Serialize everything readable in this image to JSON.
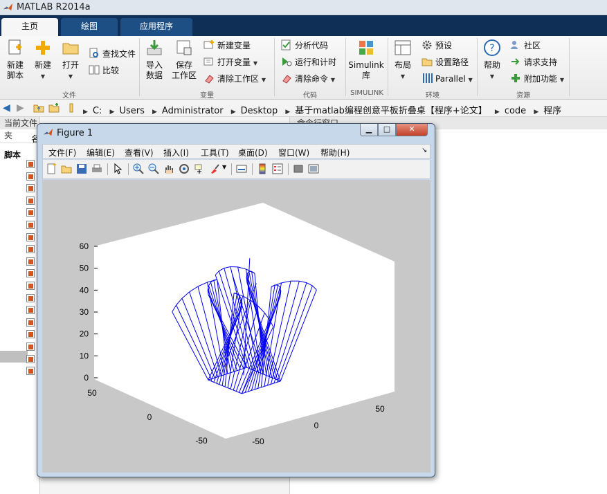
{
  "app": {
    "title": "MATLAB R2014a"
  },
  "tabs": [
    {
      "label": "主页"
    },
    {
      "label": "绘图"
    },
    {
      "label": "应用程序"
    }
  ],
  "ribbon": {
    "new_script": "新建\n脚本",
    "new": "新建",
    "open": "打开",
    "find_files": "查找文件",
    "compare": "比较",
    "import_data": "导入\n数据",
    "save_workspace": "保存\n工作区",
    "new_variable": "新建变量",
    "open_variable": "打开变量",
    "clear_workspace": "清除工作区",
    "analyze_code": "分析代码",
    "run_and_time": "运行和计时",
    "clear_commands": "清除命令",
    "simulink": "Simulink\n库",
    "layout": "布局",
    "preferences": "预设",
    "set_path": "设置路径",
    "parallel": "Parallel",
    "help": "帮助",
    "community": "社区",
    "request_support": "请求支持",
    "add_ons": "附加功能",
    "groups": {
      "file": "文件",
      "variable": "变量",
      "code": "代码",
      "simulink": "SIMULINK",
      "environment": "环境",
      "resources": "资源"
    }
  },
  "path": {
    "segments": [
      "C:",
      "Users",
      "Administrator",
      "Desktop",
      "基于matlab编程创意平板折叠桌【程序+论文】",
      "code",
      "程序"
    ]
  },
  "panels": {
    "current_folder": "当前文件夹",
    "name_col": "名",
    "scripts_label": "脚本",
    "command_window": "命令行窗口"
  },
  "figure": {
    "title": "Figure 1",
    "menus": [
      "文件(F)",
      "编辑(E)",
      "查看(V)",
      "插入(I)",
      "工具(T)",
      "桌面(D)",
      "窗口(W)",
      "帮助(H)"
    ],
    "controls": {
      "minimize": "▁",
      "maximize": "□",
      "close": "✕"
    }
  },
  "chart_data": {
    "type": "3d-line",
    "line_color": "#0000ee",
    "zticks": [
      "60",
      "50",
      "40",
      "30",
      "20",
      "10",
      "0"
    ],
    "xticks": [
      "50",
      "0",
      "-50"
    ],
    "yticks": [
      "-50",
      "0",
      "50"
    ],
    "zlim": [
      0,
      60
    ],
    "xlim": [
      -60,
      60
    ],
    "ylim": [
      -60,
      60
    ],
    "grid": false,
    "legs": 4,
    "lines_per_leg": 12
  },
  "colors": {
    "ribbon_tabs": "#0f2f56",
    "plot_line": "#0000ee"
  }
}
